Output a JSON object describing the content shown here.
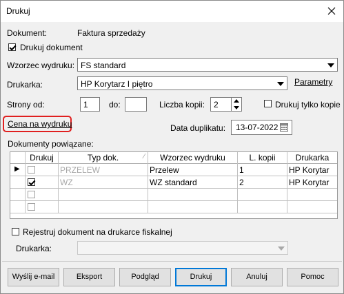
{
  "window": {
    "title": "Drukuj"
  },
  "document": {
    "label": "Dokument:",
    "value": "Faktura sprzedaży"
  },
  "print_document": {
    "label": "Drukuj dokument",
    "checked": true
  },
  "template": {
    "label": "Wzorzec wydruku:",
    "value": "FS standard"
  },
  "printer": {
    "label": "Drukarka:",
    "value": "HP Korytarz I piętro",
    "params_link": "Parametry"
  },
  "pages": {
    "from_label": "Strony od:",
    "from_value": "1",
    "to_label": "do:",
    "to_value": ""
  },
  "copies": {
    "label": "Liczba kopii:",
    "value": "2"
  },
  "copy_only": {
    "label": "Drukuj tylko kopie",
    "checked": false
  },
  "price_link": "Cena na wydruku",
  "duplicate": {
    "label": "Data duplikatu:",
    "value": "13-07-2022"
  },
  "related": {
    "label": "Dokumenty powiązane:",
    "columns": [
      "Drukuj",
      "Typ dok.",
      "Wzorzec wydruku",
      "L. kopii",
      "Drukarka"
    ],
    "rows": [
      {
        "marker": "▶",
        "print": false,
        "type": "PRZELEW",
        "template": "Przelew",
        "copies": "1",
        "printer": "HP Korytar"
      },
      {
        "marker": "",
        "print": true,
        "type": "WZ",
        "template": "WZ standard",
        "copies": "2",
        "printer": "HP Korytar"
      },
      {
        "marker": "",
        "print": false,
        "type": "",
        "template": "",
        "copies": "",
        "printer": ""
      },
      {
        "marker": "",
        "print": false,
        "type": "",
        "template": "",
        "copies": "",
        "printer": ""
      }
    ]
  },
  "fiscal": {
    "label": "Rejestruj dokument na drukarce fiskalnej",
    "checked": false,
    "printer_label": "Drukarka:",
    "printer_value": ""
  },
  "buttons": {
    "email": "Wyślij e-mail",
    "export": "Eksport",
    "preview": "Podgląd",
    "print": "Drukuj",
    "cancel": "Anuluj",
    "help": "Pomoc"
  },
  "colors": {
    "highlight": "#e02020",
    "default_button_border": "#0078d7",
    "disabled_text": "#a8a8a8"
  }
}
